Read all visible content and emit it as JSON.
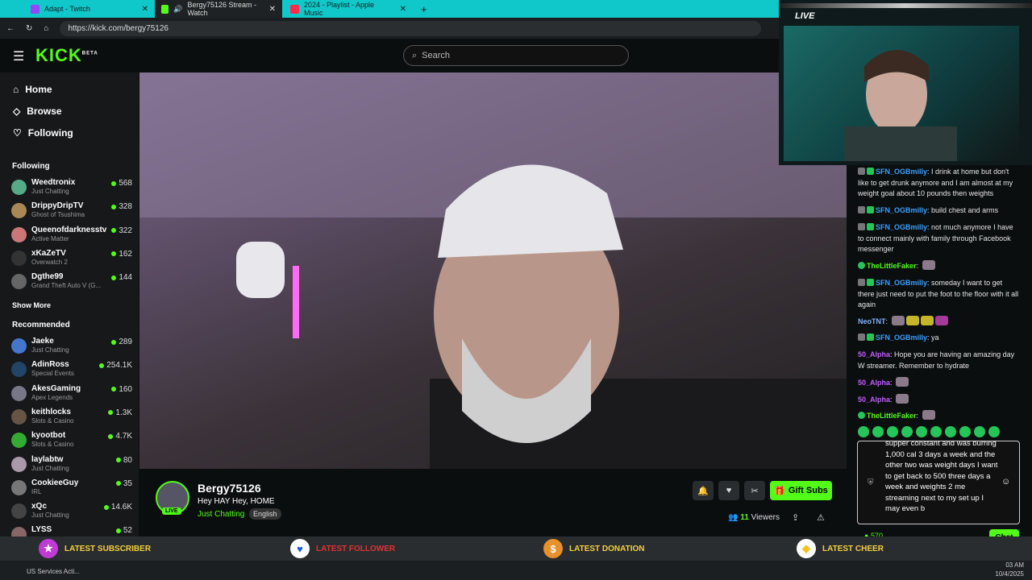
{
  "browser": {
    "tabs": [
      {
        "label": "Adapt - Twitch"
      },
      {
        "label": "Bergy75126 Stream - Watch"
      },
      {
        "label": "2024 - Playlist - Apple Music"
      }
    ],
    "url": "https://kick.com/bergy75126"
  },
  "header": {
    "logo": "KICK",
    "logo_beta": "BETA",
    "search_placeholder": "Search"
  },
  "sidebar": {
    "nav": [
      {
        "label": "Home"
      },
      {
        "label": "Browse"
      },
      {
        "label": "Following"
      }
    ],
    "following_title": "Following",
    "following": [
      {
        "name": "Weedtronix",
        "game": "Just Chatting",
        "viewers": "568"
      },
      {
        "name": "DrippyDripTV",
        "game": "Ghost of Tsushima",
        "viewers": "328"
      },
      {
        "name": "Queenofdarknesstv",
        "game": "Active Matter",
        "viewers": "322"
      },
      {
        "name": "xKaZeTV",
        "game": "Overwatch 2",
        "viewers": "162"
      },
      {
        "name": "Dgthe99",
        "game": "Grand Theft Auto V (G...",
        "viewers": "144"
      }
    ],
    "show_more": "Show More",
    "recommended_title": "Recommended",
    "recommended": [
      {
        "name": "Jaeke",
        "game": "Just Chatting",
        "viewers": "289"
      },
      {
        "name": "AdinRoss",
        "game": "Special Events",
        "viewers": "254.1K"
      },
      {
        "name": "AkesGaming",
        "game": "Apex Legends",
        "viewers": "160"
      },
      {
        "name": "keithlocks",
        "game": "Slots & Casino",
        "viewers": "1.3K"
      },
      {
        "name": "kyootbot",
        "game": "Slots & Casino",
        "viewers": "4.7K"
      },
      {
        "name": "laylabtw",
        "game": "Just Chatting",
        "viewers": "80"
      },
      {
        "name": "CookieeGuy",
        "game": "IRL",
        "viewers": "35"
      },
      {
        "name": "xQc",
        "game": "Just Chatting",
        "viewers": "14.6K"
      },
      {
        "name": "LYSS",
        "game": "",
        "viewers": "52"
      }
    ]
  },
  "stream": {
    "streamer": "Bergy75126",
    "title": "Hey HAY Hey, HOME",
    "category": "Just Chatting",
    "language": "English",
    "live_badge": "LIVE",
    "viewers_count": "11",
    "viewers_label": "Viewers",
    "gift_label": "Gift Subs"
  },
  "overlay": {
    "live_label": "LIVE"
  },
  "chat": {
    "messages": [
      {
        "user": "SFN_OGBmilly",
        "color": "#3aa0ff",
        "text": "I drink at home but don't like to get drunk anymore and I am almost at my weight goal about 10 pounds then weights"
      },
      {
        "user": "SFN_OGBmilly",
        "color": "#3aa0ff",
        "text": "build chest and arms"
      },
      {
        "user": "SFN_OGBmilly",
        "color": "#3aa0ff",
        "text": "not much anymore I have to connect mainly with family through Facebook messenger"
      },
      {
        "user": "TheLittleFaker",
        "color": "#53fc18",
        "text": ""
      },
      {
        "user": "SFN_OGBmilly",
        "color": "#3aa0ff",
        "text": "someday I want to get there just need to put the foot to the floor with it all again"
      },
      {
        "user": "NeoTNT",
        "color": "#7fb2ff",
        "text": ""
      },
      {
        "user": "SFN_OGBmilly",
        "color": "#3aa0ff",
        "text": "ya"
      },
      {
        "user": "50_Alpha",
        "color": "#c45cff",
        "text": "Hope you are having an amazing day W streamer. Remember to hydrate"
      },
      {
        "user": "50_Alpha",
        "color": "#c45cff",
        "text": ""
      },
      {
        "user": "50_Alpha",
        "color": "#c45cff",
        "text": ""
      },
      {
        "user": "TheLittleFaker",
        "color": "#53fc18",
        "text": ""
      }
    ],
    "input_text": "supper constant and was burring 1,000 cal 3 days a week and the other two was weight days I want to get back to 500 three days a week and weights 2 me streaming next to my set up I may even b",
    "chat_button": "Chat",
    "points": "570"
  },
  "alerts": [
    {
      "label": "LATEST SUBSCRIBER",
      "icon": "star-icon"
    },
    {
      "label": "LATEST FOLLOWER",
      "icon": "heart-icon"
    },
    {
      "label": "LATEST DONATION",
      "icon": "dollar-icon"
    },
    {
      "label": "LATEST CHEER",
      "icon": "diamond-icon"
    }
  ],
  "taskbar": {
    "left_text": "US Services Acti...",
    "time": "03 AM",
    "date": "10/4/2025"
  },
  "colors": {
    "accent": "#53fc18",
    "tabbar": "#10c7c9"
  }
}
